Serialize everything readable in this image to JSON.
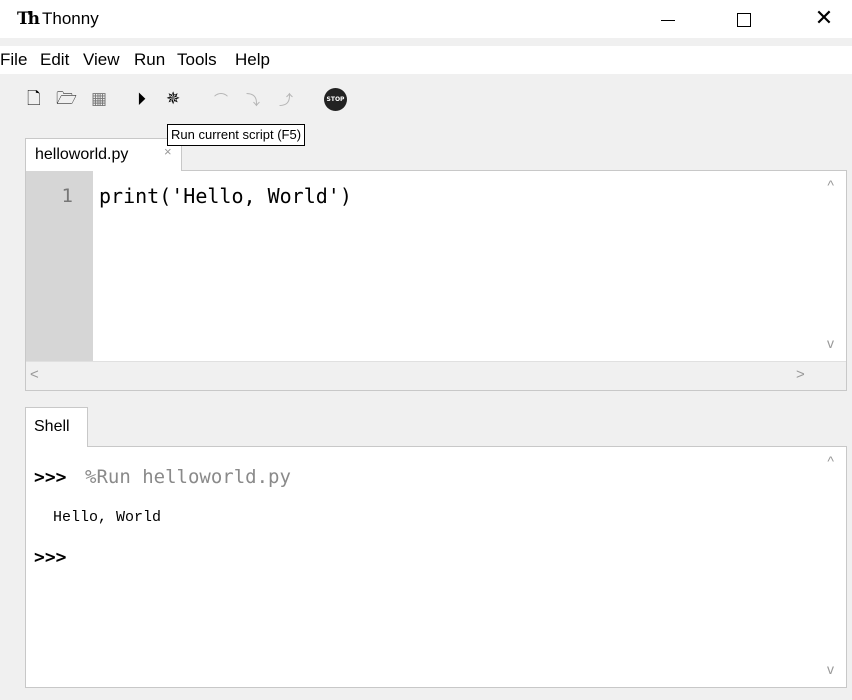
{
  "window": {
    "app_icon": "Th",
    "title": "Thonny",
    "minimize_icon": "minimize-icon",
    "maximize_icon": "maximize-icon",
    "close_glyph": "✕"
  },
  "menu": [
    "File",
    "Edit",
    "View",
    "Run",
    "Tools",
    "Help"
  ],
  "toolbar": {
    "icons": [
      "new-file-icon",
      "open-file-icon",
      "save-file-icon",
      "run-icon",
      "debug-icon",
      "step-over-icon",
      "step-into-icon",
      "step-out-icon",
      "stop-icon"
    ],
    "stop_label": "STOP",
    "tooltip": "Run current script (F5)"
  },
  "editor": {
    "tab_label": "helloworld.py",
    "tab_close": "×",
    "line_numbers": [
      "1"
    ],
    "lines": [
      "print('Hello, World')"
    ]
  },
  "shell": {
    "tab_label": "Shell",
    "prompt": ">>>",
    "command": "%Run helloworld.py",
    "output": "Hello, World"
  },
  "scroll": {
    "up": "^",
    "down": "v",
    "left": "<",
    "right": ">"
  }
}
